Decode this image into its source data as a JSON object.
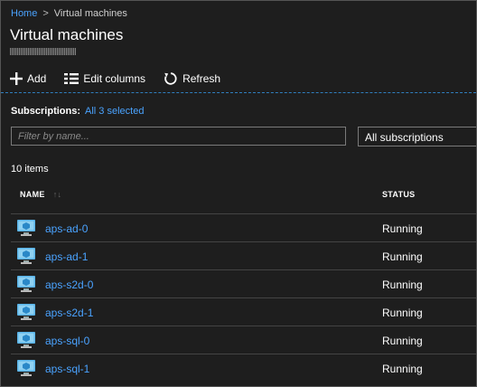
{
  "breadcrumb": {
    "home": "Home",
    "separator": ">",
    "current": "Virtual machines"
  },
  "title": "Virtual machines",
  "toolbar": {
    "add": "Add",
    "edit_columns": "Edit columns",
    "refresh": "Refresh"
  },
  "subscriptions": {
    "label": "Subscriptions:",
    "value": "All 3 selected"
  },
  "filter": {
    "placeholder": "Filter by name...",
    "value": ""
  },
  "subscription_select": {
    "selected": "All subscriptions"
  },
  "item_count": "10 items",
  "columns": {
    "name": "NAME",
    "status": "STATUS"
  },
  "rows": [
    {
      "name": "aps-ad-0",
      "status": "Running"
    },
    {
      "name": "aps-ad-1",
      "status": "Running"
    },
    {
      "name": "aps-s2d-0",
      "status": "Running"
    },
    {
      "name": "aps-s2d-1",
      "status": "Running"
    },
    {
      "name": "aps-sql-0",
      "status": "Running"
    },
    {
      "name": "aps-sql-1",
      "status": "Running"
    }
  ],
  "colors": {
    "link": "#4aa3ff",
    "background": "#1e1e1e",
    "divider": "#444444",
    "accent_dash": "#2f7fbf"
  },
  "icons": {
    "add": "plus-icon",
    "edit_columns": "columns-icon",
    "refresh": "refresh-icon",
    "vm": "virtual-machine-icon",
    "sort": "sort-icon"
  }
}
